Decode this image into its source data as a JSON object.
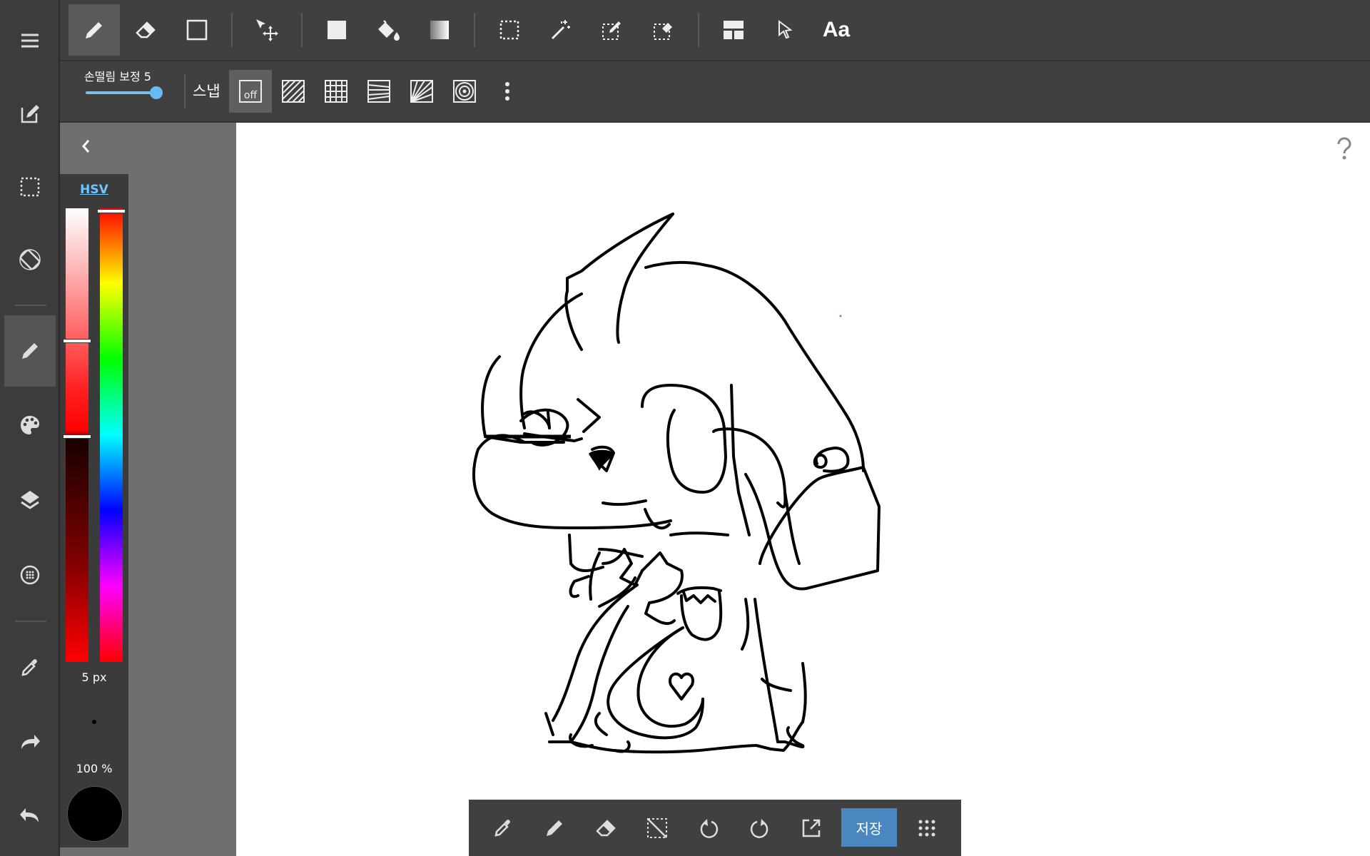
{
  "left_rail": {
    "items": [
      {
        "name": "menu-icon"
      },
      {
        "name": "edit-icon"
      },
      {
        "name": "selection-icon"
      },
      {
        "name": "rotate-icon"
      },
      {
        "name": "pen-icon",
        "active": true
      },
      {
        "name": "palette-icon"
      },
      {
        "name": "layers-icon"
      },
      {
        "name": "material-icon"
      },
      {
        "name": "eyedropper-icon"
      },
      {
        "name": "redo-icon"
      },
      {
        "name": "undo-icon"
      }
    ]
  },
  "toolbar": {
    "tools": [
      {
        "name": "pen-tool-icon",
        "active": true
      },
      {
        "name": "eraser-tool-icon"
      },
      {
        "name": "shape-tool-icon"
      },
      {
        "name": "move-tool-icon"
      },
      {
        "name": "fill-color-icon"
      },
      {
        "name": "bucket-tool-icon"
      },
      {
        "name": "gradient-tool-icon"
      },
      {
        "name": "select-rect-icon"
      },
      {
        "name": "magic-wand-icon"
      },
      {
        "name": "select-pen-icon"
      },
      {
        "name": "select-eraser-icon"
      },
      {
        "name": "frame-divide-icon"
      },
      {
        "name": "operation-cursor-icon"
      }
    ],
    "text_tool_label": "Aa"
  },
  "sub_toolbar": {
    "stabilizer_label": "손떨림 보정 5",
    "stabilizer_value": 5,
    "snap_label": "스냅",
    "snap_off_label": "off",
    "snap_options": [
      "snap-off-icon",
      "snap-parallel-icon",
      "snap-grid-icon",
      "snap-perspective-icon",
      "snap-radial-icon",
      "snap-circle-icon",
      "more-vert-icon"
    ]
  },
  "color_panel": {
    "mode_tab": "HSV",
    "brush_size": "5 px",
    "opacity": "100 %",
    "current_color": "#000000",
    "hue_color": "#ff0000"
  },
  "bottom_bar": {
    "save_label": "저장",
    "tools": [
      "eyedropper-icon",
      "pen-icon",
      "eraser-icon",
      "deselect-icon",
      "undo-icon",
      "redo-icon",
      "export-icon",
      "apps-grid-icon"
    ]
  },
  "colors": {
    "accent": "#4a86c0",
    "toolbar_bg": "#404040",
    "rail_bg": "#3c3c3c",
    "hsv_tab": "#6ec6ff"
  }
}
